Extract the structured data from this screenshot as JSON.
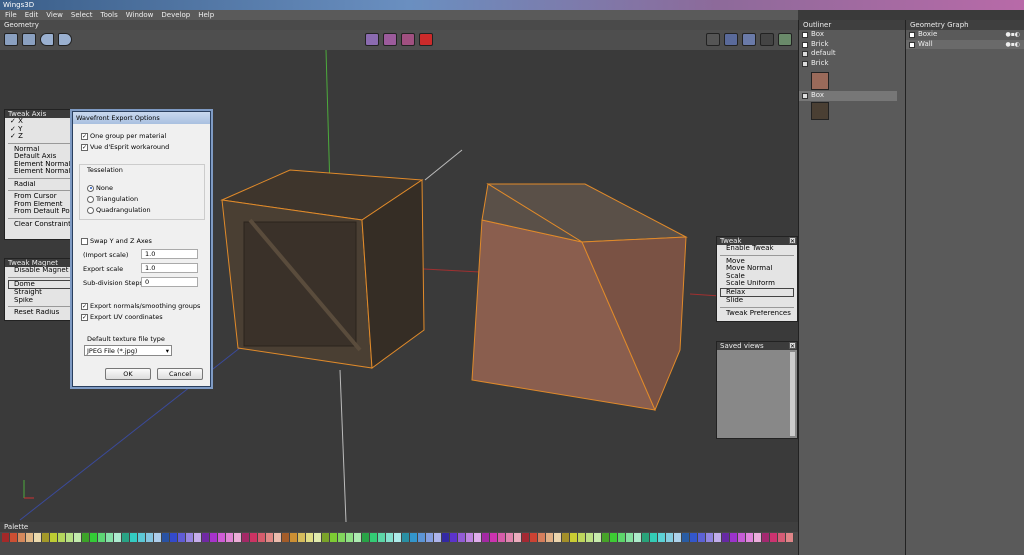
{
  "app": {
    "title": "Wings3D"
  },
  "menu": [
    "File",
    "Edit",
    "View",
    "Select",
    "Tools",
    "Window",
    "Develop",
    "Help"
  ],
  "geometry_header": "Geometry",
  "tweak_axis": {
    "title": "Tweak Axis",
    "items": [
      "✓ X",
      "✓ Y",
      "✓ Z",
      "Normal",
      "Default Axis",
      "Element Normal",
      "Element Normal (ed",
      "Radial",
      "From Cursor",
      "From Element",
      "From Default Point",
      "Clear Constraints"
    ]
  },
  "tweak_magnet": {
    "title": "Tweak Magnet",
    "items": [
      "Disable Magnet",
      "Dome",
      "Straight",
      "Spike",
      "Reset Radius"
    ],
    "selected": "Dome"
  },
  "dialog": {
    "title": "Wavefront Export Options",
    "one_group": "One group per material",
    "vue": "Vue d'Esprit workaround",
    "tesselation": "Tesselation",
    "none": "None",
    "triangulation": "Triangulation",
    "quad": "Quadrangulation",
    "swap": "Swap Y and Z Axes",
    "import_scale_label": "(Import scale)",
    "import_scale": "1.0",
    "export_scale_label": "Export scale",
    "export_scale": "1.0",
    "subdiv_label": "Sub-division Steps",
    "subdiv": "0",
    "normals": "Export normals/smoothing groups",
    "uv": "Export UV coordinates",
    "texture_label": "Default texture file type",
    "texture_value": "JPEG File (*.jpg)",
    "ok": "OK",
    "cancel": "Cancel"
  },
  "tweak": {
    "title": "Tweak",
    "items": [
      "Enable Tweak",
      "Move",
      "Move Normal",
      "Scale",
      "Scale Uniform",
      "Relax",
      "Slide",
      "Tweak Preferences"
    ],
    "selected": "Relax"
  },
  "saved_views": {
    "title": "Saved views"
  },
  "outliner": {
    "title": "Outliner",
    "items": [
      "Box",
      "Brick",
      "default",
      "Brick",
      "Box"
    ]
  },
  "geometry_graph": {
    "title": "Geometry Graph",
    "items": [
      "Boxie",
      "Wall"
    ]
  },
  "palette": {
    "title": "Palette"
  },
  "colors": {
    "selection": "#e08a2a",
    "accent": "#cc2a2a"
  }
}
